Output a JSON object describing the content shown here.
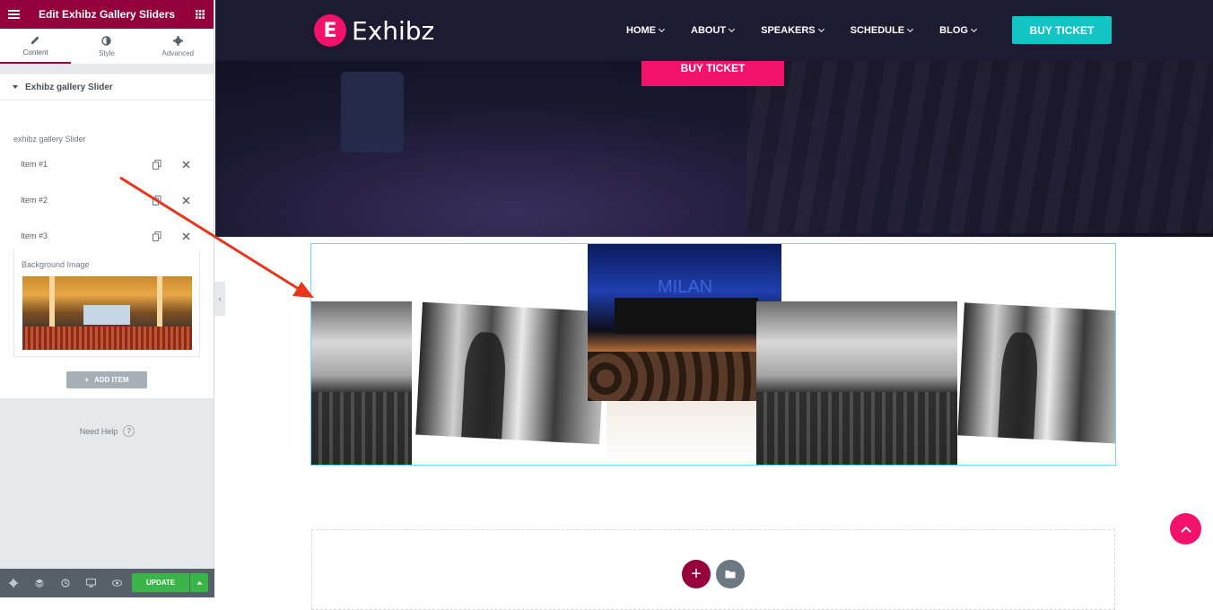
{
  "panel": {
    "title": "Edit Exhibz Gallery Sliders",
    "tabs": [
      {
        "label": "Content",
        "icon": "pencil-icon"
      },
      {
        "label": "Style",
        "icon": "half-circle-icon"
      },
      {
        "label": "Advanced",
        "icon": "gear-icon"
      }
    ],
    "section_title": "Exhibz gallery Slider",
    "control_label": "exhibz gallery Slider",
    "items": [
      "Item #1",
      "Item #2",
      "Item #3"
    ],
    "bg_image_label": "Background Image",
    "add_item_label": "ADD ITEM",
    "need_help": "Need Help",
    "update_label": "UPDATE"
  },
  "site": {
    "logo_text": "Exhibz",
    "logo_letter": "E",
    "nav": [
      "HOME",
      "ABOUT",
      "SPEAKERS",
      "SCHEDULE",
      "BLOG"
    ],
    "buy_ticket_nav": "BUY TICKET",
    "buy_ticket_hero": "BUY TICKET",
    "stage_sign": "MILAN"
  },
  "colors": {
    "panel_header": "#93003c",
    "accent_pink": "#f2116b",
    "accent_teal": "#12c4c4",
    "update_green": "#39b54a",
    "annotation_arrow": "#e8361c"
  }
}
